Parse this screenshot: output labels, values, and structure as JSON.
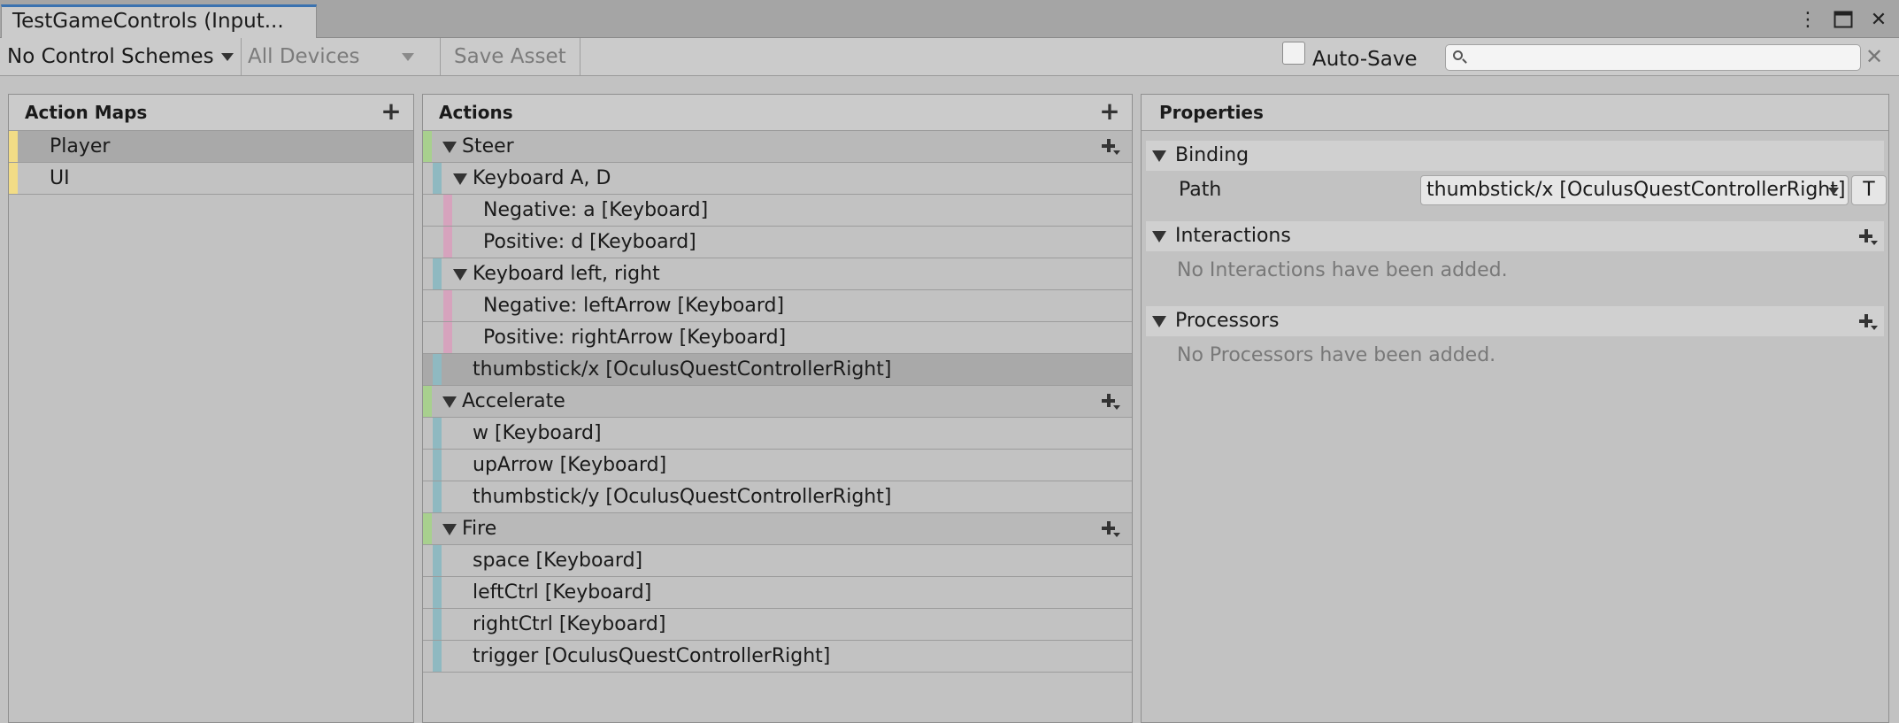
{
  "tab": {
    "title": "TestGameControls (Input..."
  },
  "window_controls": {
    "more_glyph": "⋮",
    "maximize_glyph": "🗖",
    "close_glyph": "✕"
  },
  "toolbar": {
    "control_schemes": "No Control Schemes",
    "devices": "All Devices",
    "save_asset": "Save Asset",
    "auto_save_label": "Auto-Save",
    "auto_save_checked": false,
    "search_value": "",
    "search_placeholder": "",
    "clear_glyph": "✕"
  },
  "action_maps": {
    "title": "Action Maps",
    "add_glyph": "+",
    "items": [
      {
        "label": "Player",
        "selected": true,
        "color": "#f2dc86"
      },
      {
        "label": "UI",
        "selected": false,
        "color": "#f2dc86"
      }
    ]
  },
  "actions": {
    "title": "Actions",
    "add_glyph": "+",
    "rows": [
      {
        "label": "Steer",
        "level": 0,
        "type": "action",
        "expanded": true
      },
      {
        "label": "Keyboard A, D",
        "level": 1,
        "type": "composite",
        "expanded": true
      },
      {
        "label": "Negative: a [Keyboard]",
        "level": 2,
        "type": "part"
      },
      {
        "label": "Positive: d [Keyboard]",
        "level": 2,
        "type": "part"
      },
      {
        "label": "Keyboard left, right",
        "level": 1,
        "type": "composite",
        "expanded": true
      },
      {
        "label": "Negative: leftArrow [Keyboard]",
        "level": 2,
        "type": "part"
      },
      {
        "label": "Positive: rightArrow [Keyboard]",
        "level": 2,
        "type": "part"
      },
      {
        "label": "thumbstick/x [OculusQuestControllerRight]",
        "level": 1,
        "type": "binding",
        "selected": true
      },
      {
        "label": "Accelerate",
        "level": 0,
        "type": "action",
        "expanded": true
      },
      {
        "label": "w [Keyboard]",
        "level": 1,
        "type": "binding"
      },
      {
        "label": "upArrow [Keyboard]",
        "level": 1,
        "type": "binding"
      },
      {
        "label": "thumbstick/y [OculusQuestControllerRight]",
        "level": 1,
        "type": "binding"
      },
      {
        "label": "Fire",
        "level": 0,
        "type": "action",
        "expanded": true
      },
      {
        "label": "space [Keyboard]",
        "level": 1,
        "type": "binding"
      },
      {
        "label": "leftCtrl [Keyboard]",
        "level": 1,
        "type": "binding"
      },
      {
        "label": "rightCtrl [Keyboard]",
        "level": 1,
        "type": "binding"
      },
      {
        "label": "trigger [OculusQuestControllerRight]",
        "level": 1,
        "type": "binding"
      }
    ],
    "colors": {
      "action": "#a8d08e",
      "binding": "#8fb9c1",
      "part": "#d6a3bd"
    }
  },
  "properties": {
    "title": "Properties",
    "binding_header": "Binding",
    "path_label": "Path",
    "path_value": "thumbstick/x [OculusQuestControllerRight]",
    "t_button": "T",
    "interactions_header": "Interactions",
    "interactions_empty": "No Interactions have been added.",
    "processors_header": "Processors",
    "processors_empty": "No Processors have been added."
  }
}
